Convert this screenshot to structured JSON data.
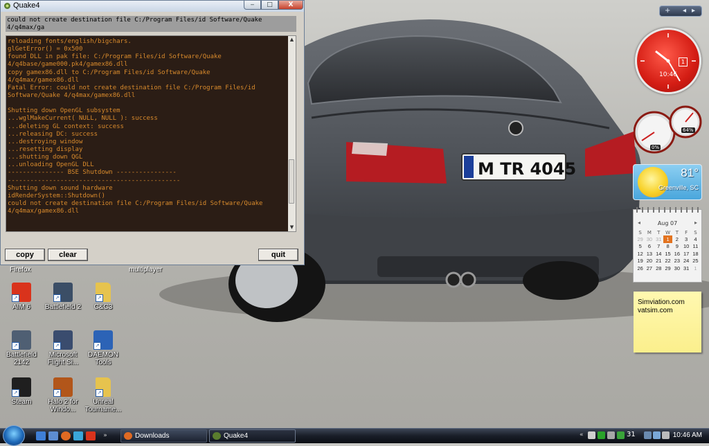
{
  "window": {
    "title": "Quake4",
    "minimize_glyph": "‒",
    "maximize_glyph": "□",
    "close_glyph": "X",
    "input_lines": [
      "could not create destination file C:/Program Files/id Software/Quake",
      "4/q4max/ga"
    ],
    "log_lines": [
      "reloading fonts/english/bigchars.",
      "glGetError() = 0x500",
      "found DLL in pak file: C:/Program Files/id Software/Quake",
      "4/q4base/game000.pk4/gamex86.dll",
      "copy gamex86.dll to C:/Program Files/id Software/Quake",
      "4/q4max/gamex86.dll",
      "Fatal Error: could not create destination file C:/Program Files/id",
      "Software/Quake 4/q4max/gamex86.dll",
      "",
      "Shutting down OpenGL subsystem",
      "...wglMakeCurrent( NULL, NULL ): success",
      "...deleting GL context: success",
      "...releasing DC: success",
      "...destroying window",
      "...resetting display",
      "...shutting down QGL",
      "...unloading OpenGL DLL",
      "--------------- BSE Shutdown ----------------",
      "----------------------------------------------",
      "Shutting down sound hardware",
      "idRenderSystem::Shutdown()",
      "could not create destination file C:/Program Files/id Software/Quake",
      "4/q4max/gamex86.dll"
    ],
    "buttons": {
      "copy": "copy",
      "clear": "clear",
      "quit": "quit"
    },
    "scroll_position": 0.85
  },
  "desktop": {
    "partial_labels": {
      "firefox": "Firefox",
      "multiplayer": "multiplayer"
    },
    "icons": [
      {
        "label": "AIM 6",
        "icon": "aim-icon",
        "color": "#d9331c"
      },
      {
        "label": "Battlefield 2",
        "icon": "battlefield2-icon",
        "color": "#3b4e66"
      },
      {
        "label": "C&C3",
        "icon": "folder-icon",
        "color": "#e6c34e"
      },
      {
        "label": "Battlefield 2142",
        "icon": "battlefield2142-icon",
        "color": "#4f5f73"
      },
      {
        "label": "Microsoft Flight Si...",
        "icon": "flight-sim-icon",
        "color": "#3a4c6e"
      },
      {
        "label": "DAEMON Tools",
        "icon": "daemon-tools-icon",
        "color": "#2c63b6"
      },
      {
        "label": "Steam",
        "icon": "steam-icon",
        "color": "#1f1f1f"
      },
      {
        "label": "Halo 2 for Windo...",
        "icon": "halo2-icon",
        "color": "#b2561a"
      },
      {
        "label": "Unreal Tourname...",
        "icon": "folder-icon",
        "color": "#e6c34e"
      }
    ]
  },
  "sidebar": {
    "controls": {
      "add": "+",
      "prev": "◂",
      "next": "▸"
    },
    "clock": {
      "time": "10:46",
      "day": "1"
    },
    "cpu": {
      "cpu_percent": "0%",
      "memory_percent": "64%"
    },
    "weather": {
      "temp": "81°",
      "city": "Greenville, SC"
    },
    "calendar": {
      "month": "Aug 07",
      "weekdays": [
        "S",
        "M",
        "T",
        "W",
        "T",
        "F",
        "S"
      ],
      "weeks": [
        [
          "29",
          "30",
          "31",
          "1",
          "2",
          "3",
          "4"
        ],
        [
          "5",
          "6",
          "7",
          "8",
          "9",
          "10",
          "11"
        ],
        [
          "12",
          "13",
          "14",
          "15",
          "16",
          "17",
          "18"
        ],
        [
          "19",
          "20",
          "21",
          "22",
          "23",
          "24",
          "25"
        ],
        [
          "26",
          "27",
          "28",
          "29",
          "30",
          "31",
          "1"
        ]
      ],
      "today": "1"
    },
    "note": {
      "line1": "Simviation.com",
      "line2": "vatsim.com"
    }
  },
  "taskbar": {
    "tasks": [
      {
        "label": "Downloads",
        "icon": "firefox-icon"
      },
      {
        "label": "Quake4",
        "icon": "quake4-icon"
      }
    ],
    "tray_day": "31",
    "clock": "10:46 AM"
  }
}
